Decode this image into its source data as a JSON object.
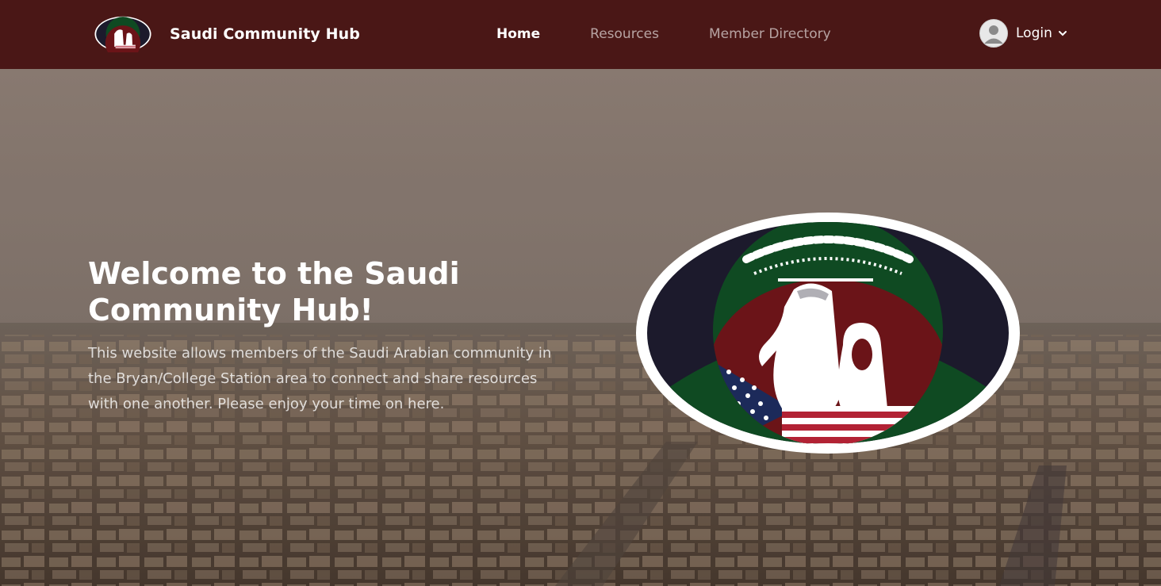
{
  "navbar": {
    "brand_name": "Saudi Community Hub",
    "links": [
      {
        "label": "Home",
        "active": true
      },
      {
        "label": "Resources",
        "active": false
      },
      {
        "label": "Member Directory",
        "active": false
      }
    ],
    "login_label": "Login",
    "background_color": "#4a1716"
  },
  "hero": {
    "title": "Welcome to the Saudi Community Hub!",
    "description": "This website allows members of the Saudi Arabian community in the Bryan/College Station area to connect and share resources with one another. Please enjoy your time on here."
  },
  "colors": {
    "emblem_green": "#0f4a22",
    "emblem_maroon": "#6b1418",
    "emblem_navy": "#1c1a2c"
  },
  "icons": {
    "user": "user-avatar-icon",
    "chevron": "chevron-down-icon"
  }
}
